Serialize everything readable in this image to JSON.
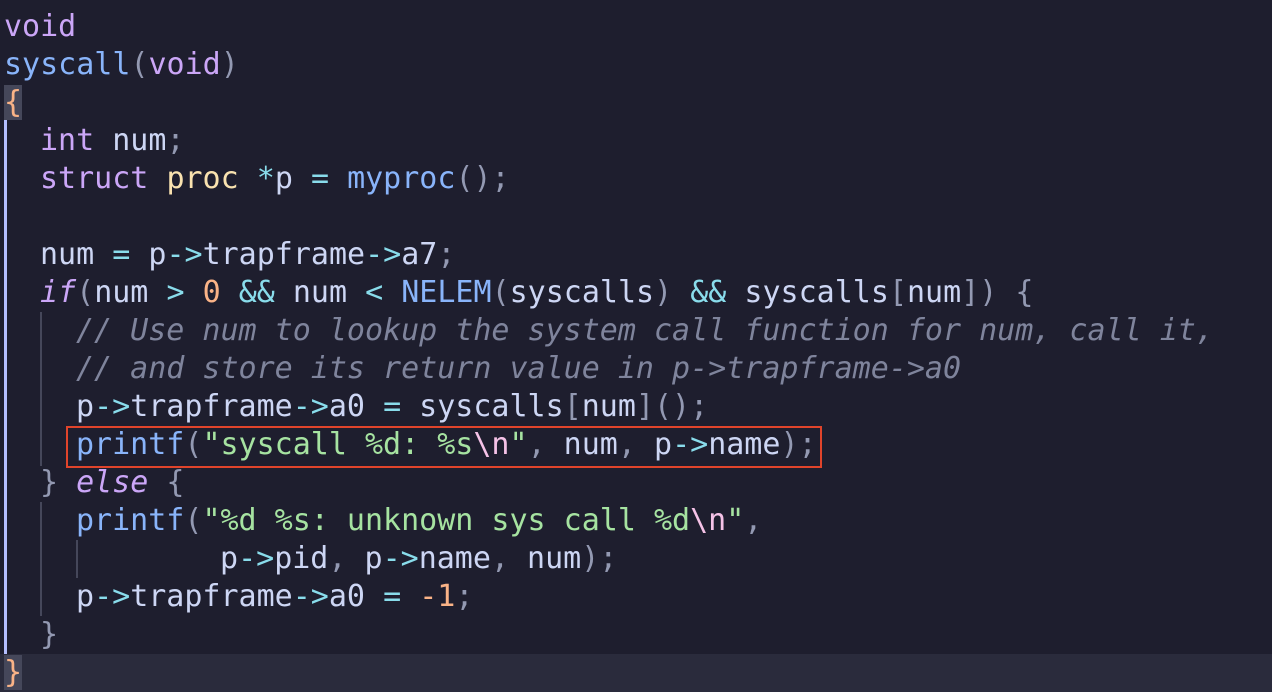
{
  "editor": {
    "lines": [
      {
        "tokens": [
          {
            "t": "void",
            "c": "kw"
          }
        ]
      },
      {
        "tokens": [
          {
            "t": "syscall",
            "c": "fn"
          },
          {
            "t": "(",
            "c": "punc"
          },
          {
            "t": "void",
            "c": "kw"
          },
          {
            "t": ")",
            "c": "punc"
          }
        ]
      },
      {
        "tokens": [
          {
            "t": "{",
            "c": "brace-match"
          }
        ]
      },
      {
        "tokens": [
          {
            "t": "int",
            "c": "kw"
          },
          {
            "t": " num",
            "c": "ident"
          },
          {
            "t": ";",
            "c": "punc"
          }
        ]
      },
      {
        "tokens": [
          {
            "t": "struct",
            "c": "kw"
          },
          {
            "t": " ",
            "c": "ident"
          },
          {
            "t": "proc",
            "c": "type"
          },
          {
            "t": " ",
            "c": "ident"
          },
          {
            "t": "*",
            "c": "op"
          },
          {
            "t": "p ",
            "c": "ident"
          },
          {
            "t": "=",
            "c": "op"
          },
          {
            "t": " ",
            "c": "ident"
          },
          {
            "t": "myproc",
            "c": "fn"
          },
          {
            "t": "();",
            "c": "punc"
          }
        ]
      },
      {
        "tokens": []
      },
      {
        "tokens": [
          {
            "t": "num ",
            "c": "ident"
          },
          {
            "t": "=",
            "c": "op"
          },
          {
            "t": " p",
            "c": "ident"
          },
          {
            "t": "->",
            "c": "op"
          },
          {
            "t": "trapframe",
            "c": "ident"
          },
          {
            "t": "->",
            "c": "op"
          },
          {
            "t": "a7",
            "c": "ident"
          },
          {
            "t": ";",
            "c": "punc"
          }
        ]
      },
      {
        "tokens": [
          {
            "t": "if",
            "c": "kwi"
          },
          {
            "t": "(",
            "c": "punc"
          },
          {
            "t": "num ",
            "c": "ident"
          },
          {
            "t": ">",
            "c": "op"
          },
          {
            "t": " ",
            "c": "ident"
          },
          {
            "t": "0",
            "c": "num"
          },
          {
            "t": " ",
            "c": "ident"
          },
          {
            "t": "&&",
            "c": "op"
          },
          {
            "t": " num ",
            "c": "ident"
          },
          {
            "t": "<",
            "c": "op"
          },
          {
            "t": " ",
            "c": "ident"
          },
          {
            "t": "NELEM",
            "c": "fn"
          },
          {
            "t": "(",
            "c": "punc"
          },
          {
            "t": "syscalls",
            "c": "ident"
          },
          {
            "t": ")",
            "c": "punc"
          },
          {
            "t": " ",
            "c": "ident"
          },
          {
            "t": "&&",
            "c": "op"
          },
          {
            "t": " syscalls",
            "c": "ident"
          },
          {
            "t": "[",
            "c": "punc"
          },
          {
            "t": "num",
            "c": "ident"
          },
          {
            "t": "])",
            "c": "punc"
          },
          {
            "t": " {",
            "c": "punc"
          }
        ]
      },
      {
        "tokens": [
          {
            "t": "// Use num to lookup the system call function for num, call it,",
            "c": "com"
          }
        ]
      },
      {
        "tokens": [
          {
            "t": "// and store its return value in p->trapframe->a0",
            "c": "com"
          }
        ]
      },
      {
        "tokens": [
          {
            "t": "p",
            "c": "ident"
          },
          {
            "t": "->",
            "c": "op"
          },
          {
            "t": "trapframe",
            "c": "ident"
          },
          {
            "t": "->",
            "c": "op"
          },
          {
            "t": "a0 ",
            "c": "ident"
          },
          {
            "t": "=",
            "c": "op"
          },
          {
            "t": " syscalls",
            "c": "ident"
          },
          {
            "t": "[",
            "c": "punc"
          },
          {
            "t": "num",
            "c": "ident"
          },
          {
            "t": "]();",
            "c": "punc"
          }
        ]
      },
      {
        "tokens": [
          {
            "t": "printf",
            "c": "fn"
          },
          {
            "t": "(",
            "c": "punc"
          },
          {
            "t": "\"syscall %d: %s",
            "c": "str"
          },
          {
            "t": "\\n",
            "c": "esc"
          },
          {
            "t": "\"",
            "c": "str"
          },
          {
            "t": ",",
            "c": "punc"
          },
          {
            "t": " num",
            "c": "ident"
          },
          {
            "t": ",",
            "c": "punc"
          },
          {
            "t": " p",
            "c": "ident"
          },
          {
            "t": "->",
            "c": "op"
          },
          {
            "t": "name",
            "c": "ident"
          },
          {
            "t": ");",
            "c": "punc"
          }
        ]
      },
      {
        "tokens": [
          {
            "t": "}",
            "c": "punc"
          },
          {
            "t": " ",
            "c": "ident"
          },
          {
            "t": "else",
            "c": "kwi"
          },
          {
            "t": " {",
            "c": "punc"
          }
        ]
      },
      {
        "tokens": [
          {
            "t": "printf",
            "c": "fn"
          },
          {
            "t": "(",
            "c": "punc"
          },
          {
            "t": "\"%d %s: unknown sys call %d",
            "c": "str"
          },
          {
            "t": "\\n",
            "c": "esc"
          },
          {
            "t": "\"",
            "c": "str"
          },
          {
            "t": ",",
            "c": "punc"
          }
        ]
      },
      {
        "tokens": [
          {
            "t": "p",
            "c": "ident"
          },
          {
            "t": "->",
            "c": "op"
          },
          {
            "t": "pid",
            "c": "ident"
          },
          {
            "t": ",",
            "c": "punc"
          },
          {
            "t": " p",
            "c": "ident"
          },
          {
            "t": "->",
            "c": "op"
          },
          {
            "t": "name",
            "c": "ident"
          },
          {
            "t": ",",
            "c": "punc"
          },
          {
            "t": " num",
            "c": "ident"
          },
          {
            "t": ");",
            "c": "punc"
          }
        ]
      },
      {
        "tokens": [
          {
            "t": "p",
            "c": "ident"
          },
          {
            "t": "->",
            "c": "op"
          },
          {
            "t": "trapframe",
            "c": "ident"
          },
          {
            "t": "->",
            "c": "op"
          },
          {
            "t": "a0 ",
            "c": "ident"
          },
          {
            "t": "=",
            "c": "op"
          },
          {
            "t": " ",
            "c": "ident"
          },
          {
            "t": "-1",
            "c": "num"
          },
          {
            "t": ";",
            "c": "punc"
          }
        ]
      },
      {
        "tokens": [
          {
            "t": "}",
            "c": "punc"
          }
        ]
      },
      {
        "tokens": [
          {
            "t": "}",
            "c": "brace-match"
          }
        ]
      }
    ]
  },
  "theme": {
    "background": "#1e1e2e",
    "annotation_color": "#e0442b"
  }
}
